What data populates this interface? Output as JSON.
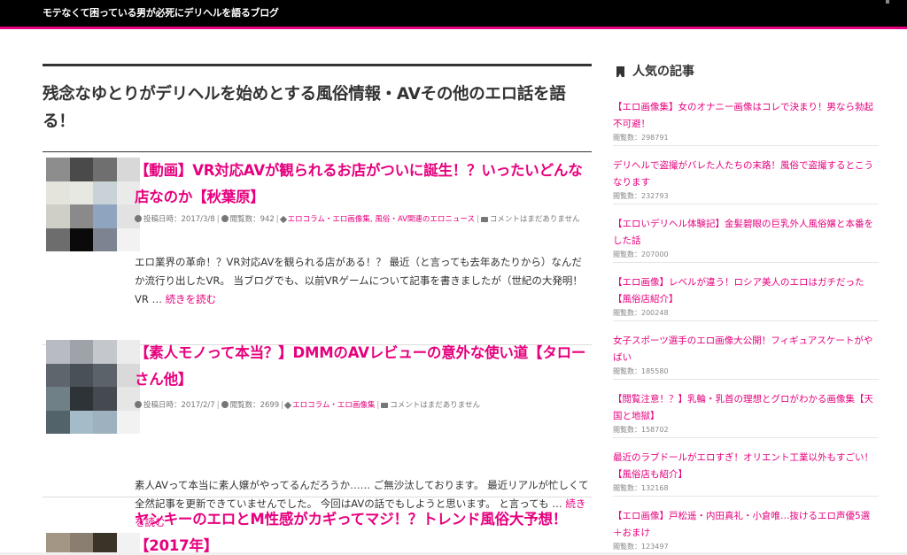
{
  "header": {
    "site_title": "モテなくて困っている男が必死にデリヘルを語るブログ"
  },
  "main": {
    "heading": "残念なゆとりがデリヘルを始めとする風俗情報・AVその他のエロ話を語る！",
    "posts": [
      {
        "title": "【動画】VR対応AVが観られるお店がついに誕生！？いったいどんな店なのか【秋葉原】",
        "date": "投稿日時：2017/3/8",
        "views": "閲覧数：942",
        "categories": "エロコラム・エロ画像集, 風俗・AV関連のエロニュース",
        "comments": "コメントはまだありません",
        "excerpt": "エロ業界の革命！？VR対応AVを観られる店がある！？ 最近（と言っても去年あたりから）なんだか流行り出したVR。 当ブログでも、以前VRゲームについて記事を書きましたが（世紀の大発明！VR … ",
        "more": "続きを読む"
      },
      {
        "title": "【素人モノって本当？】DMMのAVレビューの意外な使い道【タローさん他】",
        "date": "投稿日時：2017/2/7",
        "views": "閲覧数：2699",
        "categories": "エロコラム・エロ画像集",
        "comments": "コメントはまだありません",
        "excerpt": "素人AVって本当に素人嬢がやってるんだろうか…… ご無沙汰しております。 最近リアルが忙しくて全然記事を更新できていませんでした。 今回はAVの話でもしようと思います。 と言っても … ",
        "more": "続きを読む"
      },
      {
        "title": "ヤンキーのエロとM性感がカギってマジ！？トレンド風俗大予想！【2017年】"
      }
    ]
  },
  "sidebar": {
    "heading": "人気の記事",
    "items": [
      {
        "title": "【エロ画像集】女のオナニー画像はコレで決まり！男なら勃起不可避！",
        "views": "閲覧数：298791"
      },
      {
        "title": "デリヘルで盗撮がバレた人たちの末路！風俗で盗撮するとこうなります",
        "views": "閲覧数：232793"
      },
      {
        "title": "【エロいデリヘル体験記】金髪碧眼の巨乳外人風俗嬢と本番をした話",
        "views": "閲覧数：207000"
      },
      {
        "title": "【エロ画像】レベルが違う！ロシア美人のエロはガチだった【風俗店紹介】",
        "views": "閲覧数：200248"
      },
      {
        "title": "女子スポーツ選手のエロ画像大公開！フィギュアスケートがやばい",
        "views": "閲覧数：185580"
      },
      {
        "title": "【閲覧注意！？】乳輪・乳首の理想とグロがわかる画像集【天国と地獄】",
        "views": "閲覧数：158702"
      },
      {
        "title": "最近のラブドールがエロすぎ！オリエント工業以外もすごい！【風俗店も紹介】",
        "views": "閲覧数：132168"
      },
      {
        "title": "【エロ画像】戸松遥・内田真礼・小倉唯…抜けるエロ声優5選＋おまけ",
        "views": "閲覧数：123497"
      }
    ]
  },
  "colors": {
    "accent": "#e6007e",
    "header_bg": "#000000"
  }
}
